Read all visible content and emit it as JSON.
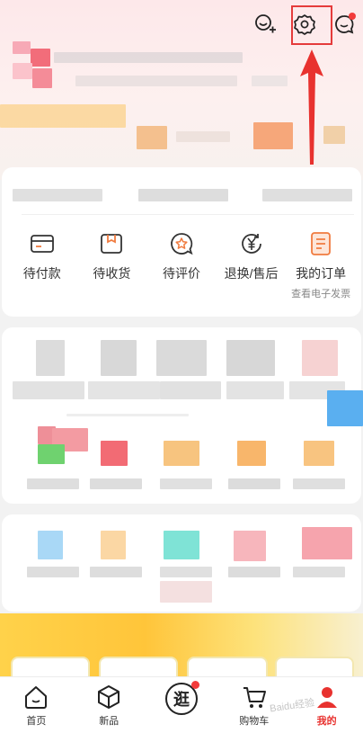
{
  "orders": {
    "items": [
      {
        "label": "待付款",
        "icon": "wallet-icon"
      },
      {
        "label": "待收货",
        "icon": "package-icon"
      },
      {
        "label": "待评价",
        "icon": "review-star-icon"
      },
      {
        "label": "退换/售后",
        "icon": "refund-yen-icon"
      },
      {
        "label": "我的订单",
        "icon": "orders-doc-icon",
        "sub": "查看电子发票"
      }
    ]
  },
  "nav": {
    "items": [
      {
        "label": "首页",
        "icon": "home-icon"
      },
      {
        "label": "新品",
        "icon": "cube-icon"
      },
      {
        "label": "逛",
        "icon": "explore-icon"
      },
      {
        "label": "购物车",
        "icon": "cart-icon"
      },
      {
        "label": "我的",
        "icon": "profile-icon",
        "active": true
      }
    ]
  },
  "watermark": "Baidu经验",
  "colors": {
    "accent": "#e8322f",
    "highlight_box": "#e53b3b",
    "order_icon_accent": "#f07b3f"
  }
}
